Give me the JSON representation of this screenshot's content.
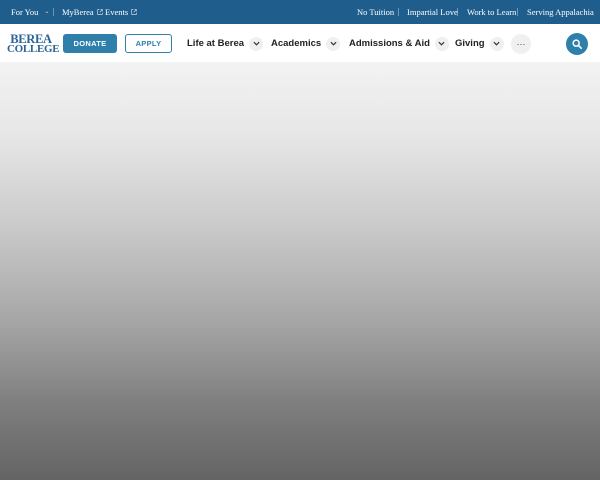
{
  "utility_bar": {
    "for_you": "For You",
    "myberea": "MyBerea",
    "events": "Events",
    "pillars": [
      "No Tuition",
      "Impartial Love",
      "Work to Learn",
      "Serving Appalachia"
    ]
  },
  "header": {
    "logo_line1": "BEREA",
    "logo_line2": "COLLEGE",
    "donate_label": "DONATE",
    "apply_label": "APPLY",
    "nav": [
      {
        "label": "Life at Berea"
      },
      {
        "label": "Academics"
      },
      {
        "label": "Admissions & Aid"
      },
      {
        "label": "Giving"
      }
    ],
    "more_label": "···"
  },
  "colors": {
    "utility_bg": "#1f5e8c",
    "brand_blue": "#2e80ab"
  },
  "icons": [
    "external-link-icon",
    "chevron-down-icon",
    "more-icon",
    "search-icon"
  ]
}
